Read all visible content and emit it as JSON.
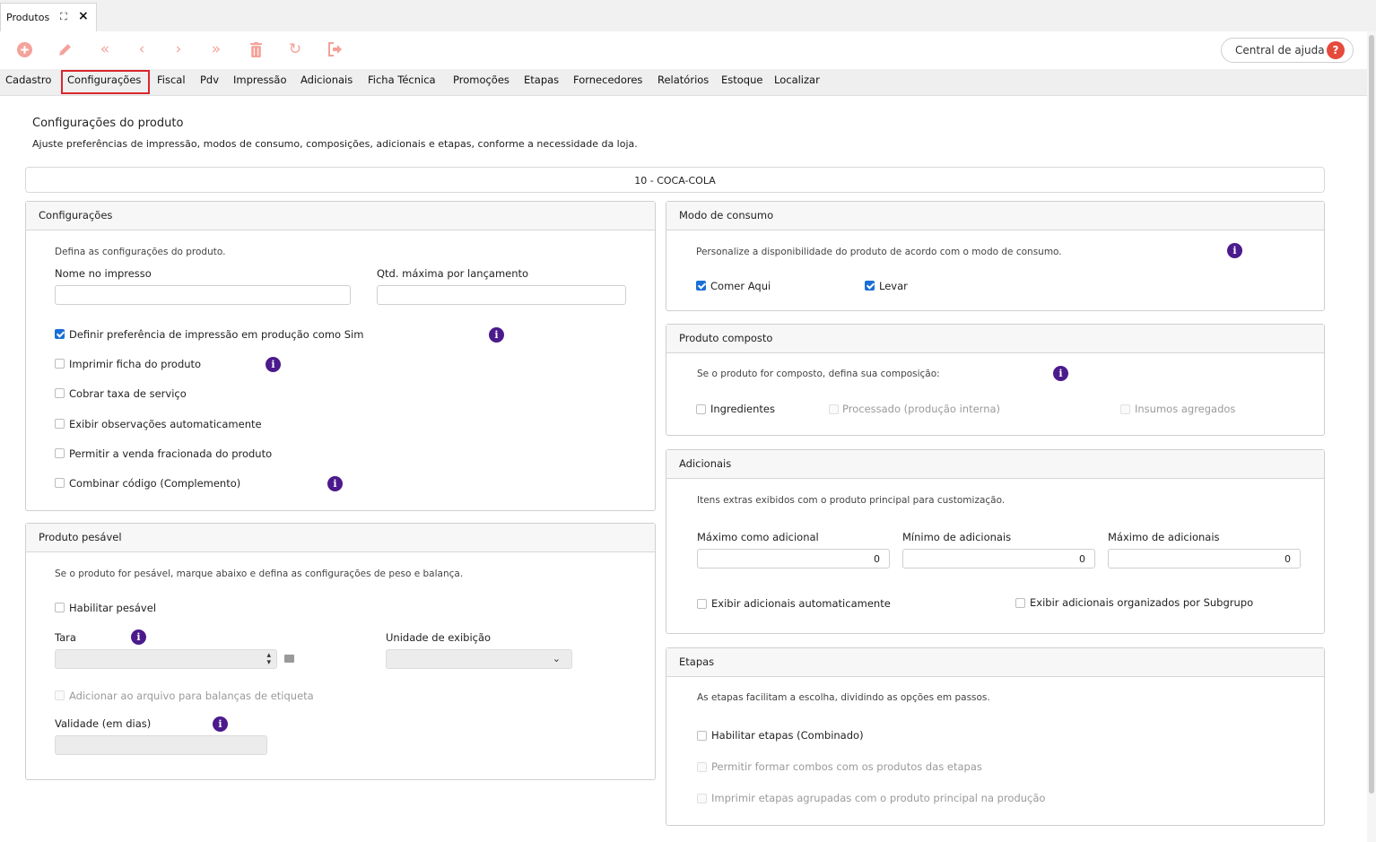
{
  "tab": {
    "label": "Produtos",
    "maximize_icon": "expand-icon",
    "close_icon": "close-icon"
  },
  "toolbar": {
    "icons": [
      "add-icon",
      "edit-icon",
      "first-icon",
      "previous-icon",
      "next-icon",
      "last-icon",
      "delete-icon",
      "refresh-icon",
      "exit-icon"
    ],
    "help_label": "Central de ajuda",
    "help_icon": "?"
  },
  "menu": {
    "items": [
      "Cadastro",
      "Configurações",
      "Fiscal",
      "Pdv",
      "Impressão",
      "Adicionais",
      "Ficha Técnica",
      "Promoções",
      "Etapas",
      "Fornecedores",
      "Relatórios",
      "Estoque",
      "Localizar"
    ],
    "active": "Configurações"
  },
  "page": {
    "title": "Configurações do produto",
    "subtitle": "Ajuste preferências de impressão, modos de consumo, composições, adicionais e etapas, conforme a necessidade da loja.",
    "product": "10 - COCA-COLA"
  },
  "configuracoes": {
    "title": "Configurações",
    "description": "Defina as configurações do produto.",
    "nome_label": "Nome no impresso",
    "nome_value": "",
    "qtd_label": "Qtd. máxima por lançamento",
    "qtd_value": "",
    "options": [
      {
        "label": "Definir preferência de impressão em produção como Sim",
        "checked": true
      },
      {
        "label": "Imprimir ficha do produto",
        "checked": false
      },
      {
        "label": "Cobrar taxa de serviço",
        "checked": false
      },
      {
        "label": "Exibir observações automaticamente",
        "checked": false
      },
      {
        "label": "Permitir a venda fracionada do produto",
        "checked": false
      },
      {
        "label": "Combinar código (Complemento)",
        "checked": false
      }
    ]
  },
  "pesavel": {
    "title": "Produto pesável",
    "description": "Se o produto for pesável, marque abaixo e defina as configurações de peso e balança.",
    "habilitar_label": "Habilitar pesável",
    "tara_label": "Tara",
    "tara_value": "",
    "unidade_label": "Unidade de exibição",
    "unidade_value": "",
    "arquivo_label": "Adicionar ao arquivo para balanças de etiqueta",
    "validade_label": "Validade (em dias)",
    "validade_value": ""
  },
  "consumo": {
    "title": "Modo de consumo",
    "description": "Personalize a disponibilidade do produto de acordo com o modo de consumo.",
    "comer_label": "Comer Aqui",
    "comer_checked": true,
    "levar_label": "Levar",
    "levar_checked": true
  },
  "composto": {
    "title": "Produto composto",
    "description": "Se o produto for composto, defina sua composição:",
    "ingredientes_label": "Ingredientes",
    "processado_label": "Processado (produção interna)",
    "insumos_label": "Insumos agregados"
  },
  "adicionais": {
    "title": "Adicionais",
    "description": "Itens extras exibidos com o produto principal para customização.",
    "max_como_label": "Máximo como adicional",
    "max_como_value": "0",
    "min_label": "Mínimo de adicionais",
    "min_value": "0",
    "max_label": "Máximo de adicionais",
    "max_value": "0",
    "auto_label": "Exibir adicionais automaticamente",
    "subgrupo_label": "Exibir adicionais organizados por Subgrupo"
  },
  "etapas": {
    "title": "Etapas",
    "description": "As etapas facilitam a escolha, dividindo as opções em passos.",
    "habilitar_label": "Habilitar etapas (Combinado)",
    "combos_label": "Permitir formar combos com os produtos das etapas",
    "imprimir_label": "Imprimir etapas agrupadas com o produto principal na produção"
  },
  "colors": {
    "accent": "#4b1a8c",
    "active_border": "#d9262c",
    "toolbar_icon": "#f4a29a",
    "checkbox": "#1a6fd6"
  }
}
